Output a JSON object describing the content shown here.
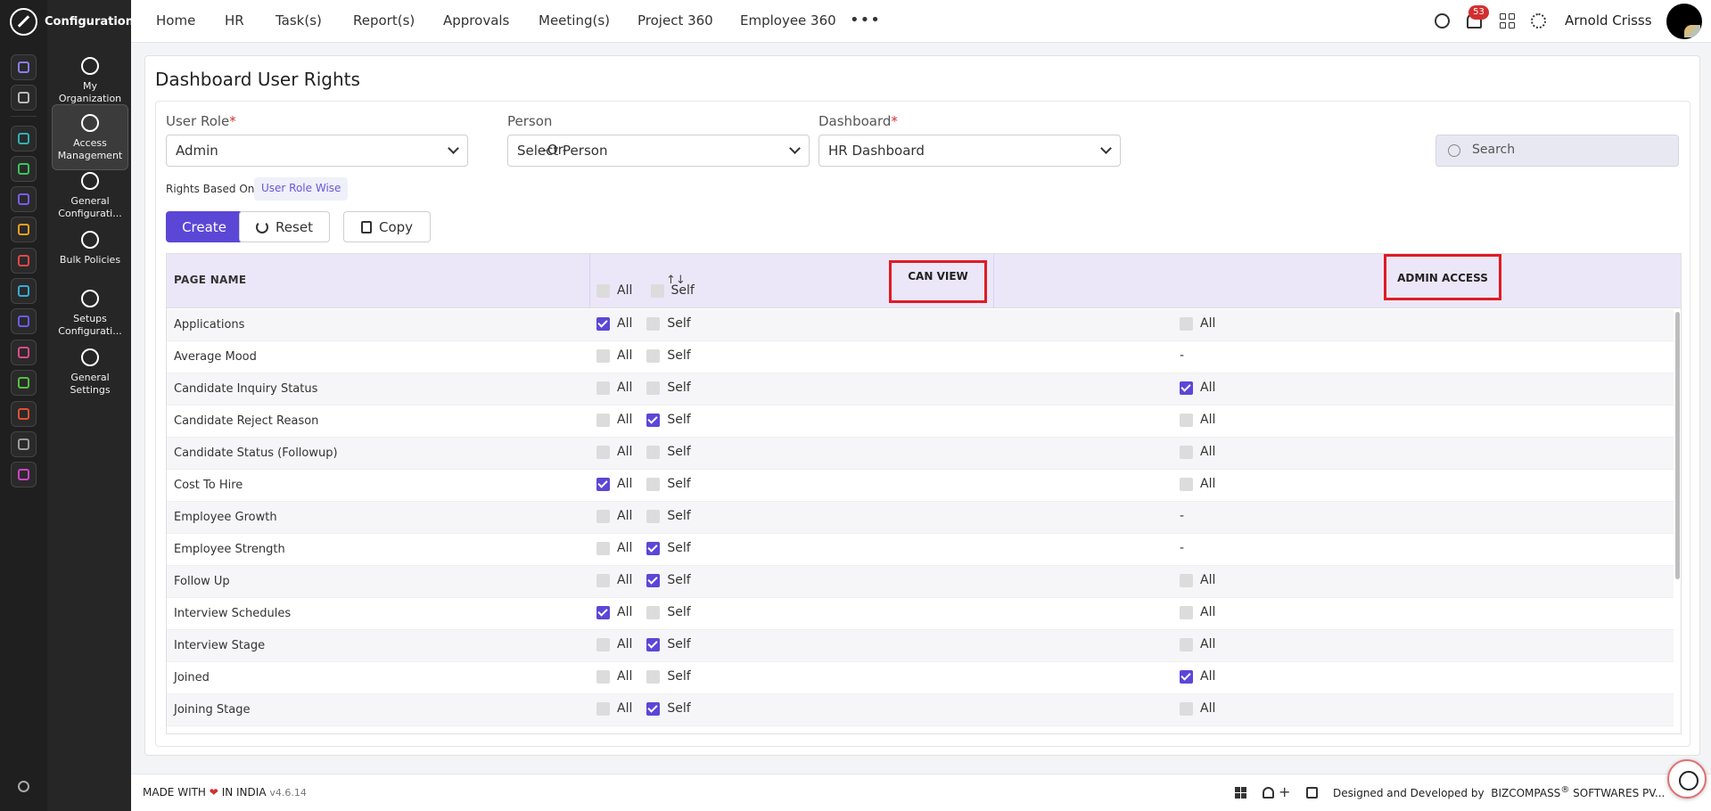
{
  "sidebar": {
    "section_title": "Configuration",
    "items": [
      {
        "label": "My Organization",
        "icon": "org-settings-icon"
      },
      {
        "label": "Access Management",
        "icon": "access-settings-icon",
        "active": true
      },
      {
        "label": "General Configurati...",
        "icon": "general-config-icon"
      },
      {
        "label": "Bulk Policies",
        "icon": "bulk-policies-icon"
      },
      {
        "label": "Setups Configurati...",
        "icon": "setups-config-icon"
      },
      {
        "label": "General Settings",
        "icon": "general-settings-icon"
      }
    ],
    "rail_icons": [
      {
        "name": "home-icon",
        "color": "#8a7cf0"
      },
      {
        "name": "pin-icon",
        "color": "#bbbbbb"
      },
      {
        "name": "people-icon",
        "color": "#2bb3b3"
      },
      {
        "name": "box-icon",
        "color": "#3cc45a"
      },
      {
        "name": "briefcase-icon",
        "color": "#7b5cf0"
      },
      {
        "name": "hands-icon",
        "color": "#f0a020"
      },
      {
        "name": "target-icon",
        "color": "#e04848"
      },
      {
        "name": "archive-icon",
        "color": "#3aa9d8"
      },
      {
        "name": "plane-icon",
        "color": "#6a5cf0"
      },
      {
        "name": "monitor-icon",
        "color": "#e04888"
      },
      {
        "name": "document-icon",
        "color": "#54c040"
      },
      {
        "name": "award-icon",
        "color": "#e05030"
      },
      {
        "name": "house-icon",
        "color": "#9a9a9a"
      },
      {
        "name": "settings-app-icon",
        "color": "#d040c8"
      }
    ]
  },
  "topbar": {
    "nav": [
      "Home",
      "HR",
      "Task(s)",
      "Report(s)",
      "Approvals",
      "Meeting(s)",
      "Project 360",
      "Employee 360"
    ],
    "more": "•••",
    "notification_count": "53",
    "user_name": "Arnold Crisss"
  },
  "page": {
    "title": "Dashboard User Rights",
    "user_role_label": "User Role",
    "user_role_value": "Admin",
    "or_text": "-Or-",
    "person_label": "Person",
    "person_value": "Select Person",
    "dashboard_label": "Dashboard",
    "dashboard_value": "HR Dashboard",
    "required_mark": "*",
    "search_placeholder": "Search",
    "rights_based_label": "Rights Based On :",
    "rights_based_value": "User Role Wise",
    "create_label": "Create",
    "reset_label": "Reset",
    "copy_label": "Copy"
  },
  "table": {
    "col_page": "PAGE NAME",
    "col_can_view": "CAN VIEW",
    "col_admin": "ADMIN ACCESS",
    "opt_all": "All",
    "opt_self": "Self",
    "dash": "-",
    "rows": [
      {
        "name": "Applications",
        "view_all": true,
        "view_self": false,
        "admin": false
      },
      {
        "name": "Average Mood",
        "view_all": false,
        "view_self": false,
        "admin": null
      },
      {
        "name": "Candidate Inquiry Status",
        "view_all": false,
        "view_self": false,
        "admin": true
      },
      {
        "name": "Candidate Reject Reason",
        "view_all": false,
        "view_self": true,
        "admin": false
      },
      {
        "name": "Candidate Status (Followup)",
        "view_all": false,
        "view_self": false,
        "admin": false
      },
      {
        "name": "Cost To Hire",
        "view_all": true,
        "view_self": false,
        "admin": false
      },
      {
        "name": "Employee Growth",
        "view_all": false,
        "view_self": false,
        "admin": null
      },
      {
        "name": "Employee Strength",
        "view_all": false,
        "view_self": true,
        "admin": null
      },
      {
        "name": "Follow Up",
        "view_all": false,
        "view_self": true,
        "admin": false
      },
      {
        "name": "Interview Schedules",
        "view_all": true,
        "view_self": false,
        "admin": false
      },
      {
        "name": "Interview Stage",
        "view_all": false,
        "view_self": true,
        "admin": false
      },
      {
        "name": "Joined",
        "view_all": false,
        "view_self": false,
        "admin": true
      },
      {
        "name": "Joining Stage",
        "view_all": false,
        "view_self": true,
        "admin": false
      }
    ]
  },
  "footer": {
    "made_with": "MADE WITH",
    "in_india": "IN INDIA",
    "version": "v4.6.14",
    "designed_by": "Designed and Developed by",
    "company": "BIZCOMPASS",
    "company_suffix": "SOFTWARES PV..."
  },
  "colors": {
    "accent": "#5b47d6",
    "highlight_box": "#e01b24",
    "header_bg": "#ebe7f8"
  }
}
